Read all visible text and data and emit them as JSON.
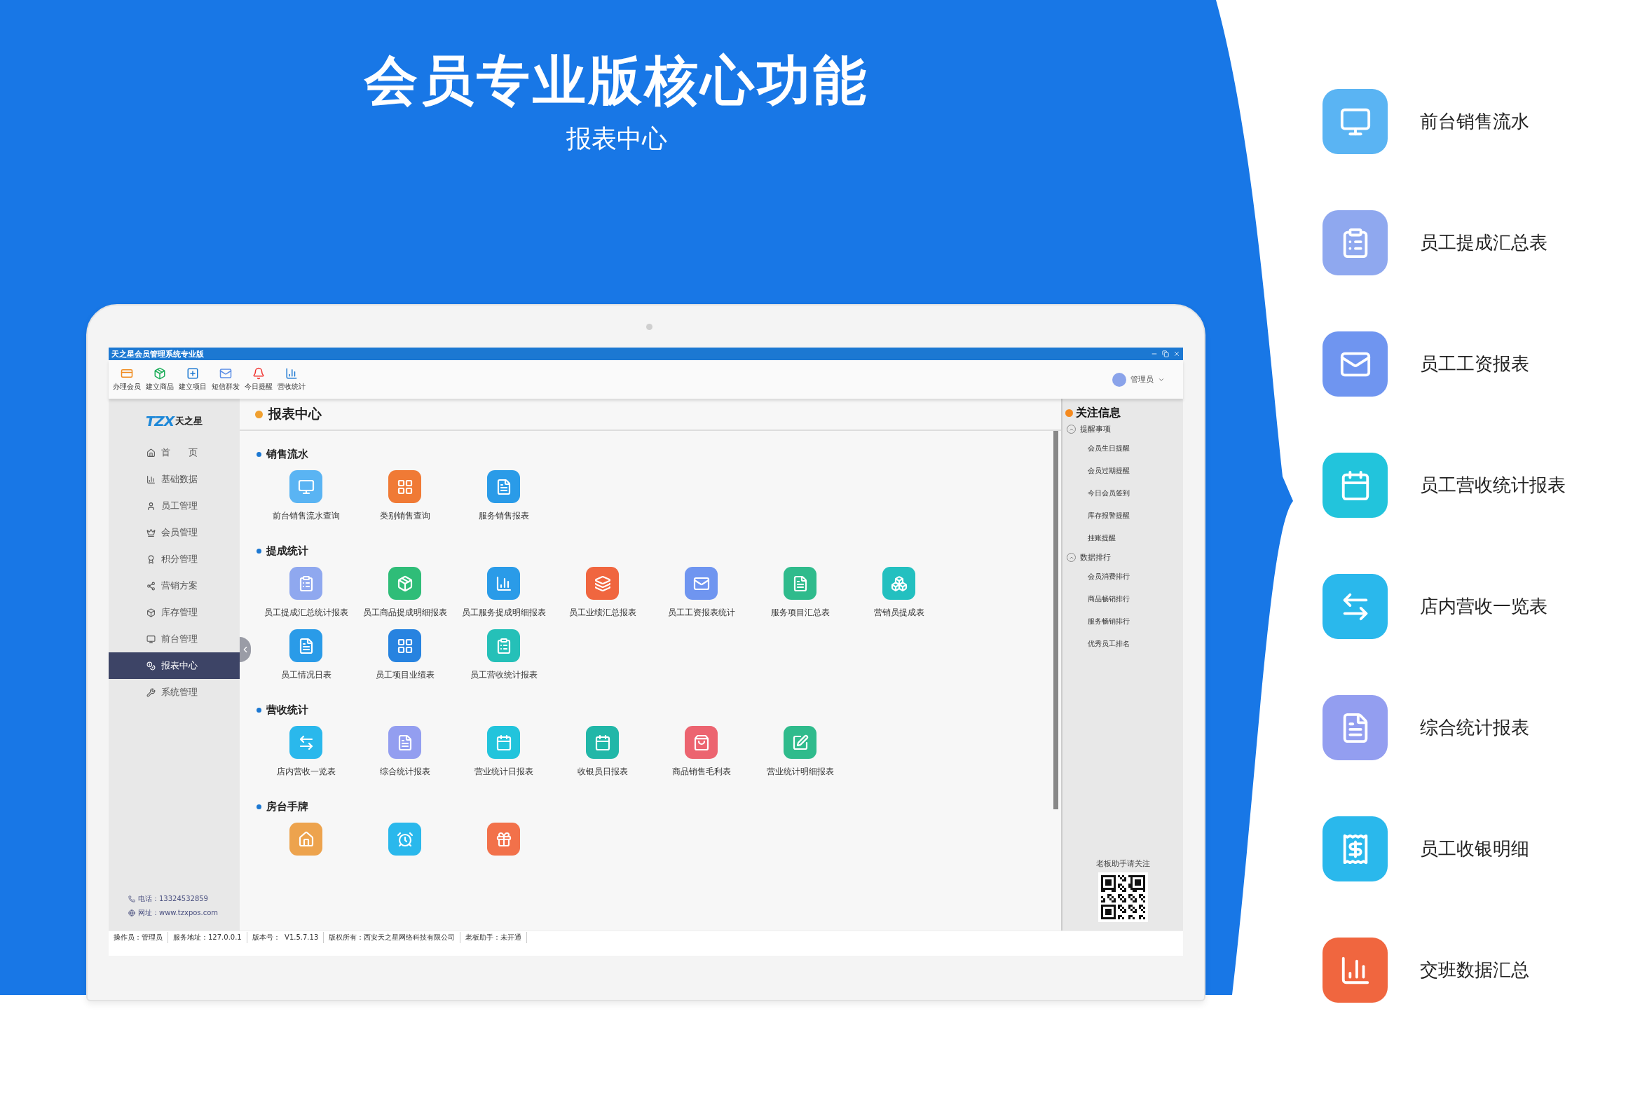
{
  "banner": {
    "title": "会员专业版核心功能",
    "subtitle": "报表中心"
  },
  "window": {
    "title": "天之星会员管理系统专业版"
  },
  "toolbar": [
    "办理会员",
    "建立商品",
    "建立项目",
    "短信群发",
    "今日提醒",
    "营收统计"
  ],
  "user": {
    "name": "管理员"
  },
  "logo": {
    "mark": "TZX",
    "name": "天之星"
  },
  "sidebar": {
    "items": [
      {
        "label": "首　　页",
        "selected": false
      },
      {
        "label": "基础数据",
        "selected": false
      },
      {
        "label": "员工管理",
        "selected": false
      },
      {
        "label": "会员管理",
        "selected": false
      },
      {
        "label": "积分管理",
        "selected": false
      },
      {
        "label": "营销方案",
        "selected": false
      },
      {
        "label": "库存管理",
        "selected": false
      },
      {
        "label": "前台管理",
        "selected": false
      },
      {
        "label": "报表中心",
        "selected": true
      },
      {
        "label": "系统管理",
        "selected": false
      }
    ],
    "contact": [
      "电话：13324532859",
      "网址：www.tzxpos.com"
    ]
  },
  "content": {
    "title": "报表中心",
    "sections": [
      {
        "title": "销售流水",
        "tiles": [
          {
            "label": "前台销售流水查询",
            "color": "#5ab4f3"
          },
          {
            "label": "类别销售查询",
            "color": "#f07a35"
          },
          {
            "label": "服务销售报表",
            "color": "#2a9be8"
          }
        ]
      },
      {
        "title": "提成统计",
        "tiles": [
          {
            "label": "员工提成汇总统计报表",
            "color": "#8fa8ef"
          },
          {
            "label": "员工商品提成明细报表",
            "color": "#2fbd78"
          },
          {
            "label": "员工服务提成明细报表",
            "color": "#2a9be8"
          },
          {
            "label": "员工业绩汇总报表",
            "color": "#f0663f"
          },
          {
            "label": "员工工资报表统计",
            "color": "#6f95f0"
          },
          {
            "label": "服务项目汇总表",
            "color": "#2fbb8c"
          },
          {
            "label": "营销员提成表",
            "color": "#23c0c0"
          },
          {
            "label": "员工情况日表",
            "color": "#2a9be8"
          },
          {
            "label": "员工项目业绩表",
            "color": "#2783e0"
          },
          {
            "label": "员工营收统计报表",
            "color": "#25c0b8"
          }
        ]
      },
      {
        "title": "营收统计",
        "tiles": [
          {
            "label": "店内营收一览表",
            "color": "#2ab8ec"
          },
          {
            "label": "综合统计报表",
            "color": "#939ef0"
          },
          {
            "label": "营业统计日报表",
            "color": "#22c4dc"
          },
          {
            "label": "收银员日报表",
            "color": "#21b7a8"
          },
          {
            "label": "商品销售毛利表",
            "color": "#ec6470"
          },
          {
            "label": "营业统计明细报表",
            "color": "#2fbb8c"
          }
        ]
      },
      {
        "title": "房台手牌",
        "tiles": [
          {
            "color": "#eda34d"
          },
          {
            "color": "#2ab8ec"
          },
          {
            "color": "#f2714a"
          }
        ]
      }
    ]
  },
  "focus_panel": {
    "title": "关注信息",
    "groups": [
      {
        "label": "提醒事项",
        "expanded": true,
        "items": [
          "会员生日提醒",
          "会员过期提醒",
          "今日会员签到",
          "库存报警提醒",
          "挂账提醒"
        ]
      },
      {
        "label": "数据排行",
        "expanded": true,
        "items": [
          "会员消费排行",
          "商品畅销排行",
          "服务畅销排行",
          "优秀员工排名"
        ]
      }
    ],
    "qr_caption": "老板助手请关注"
  },
  "status_bar": [
    "操作员：管理员",
    "服务地址：127.0.0.1",
    "版本号：  V1.5.7.13",
    "版权所有：西安天之星网络科技有限公司",
    "老板助手：未开通"
  ],
  "features": [
    {
      "label": "前台销售流水",
      "color": "#5ab4f3"
    },
    {
      "label": "员工提成汇总表",
      "color": "#8fa8ef"
    },
    {
      "label": "员工工资报表",
      "color": "#6f95f0"
    },
    {
      "label": "员工营收统计报表",
      "color": "#22c4dc"
    },
    {
      "label": "店内营收一览表",
      "color": "#2ab8ec"
    },
    {
      "label": "综合统计报表",
      "color": "#939ef0"
    },
    {
      "label": "员工收银明细",
      "color": "#2ab8ec"
    },
    {
      "label": "交班数据汇总",
      "color": "#f0663f"
    }
  ]
}
